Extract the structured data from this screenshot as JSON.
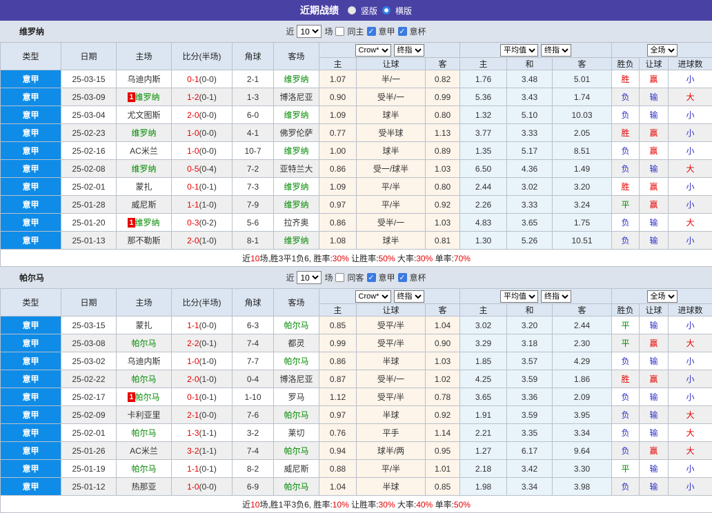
{
  "header_bar": {
    "title": "近期战绩",
    "radio_vertical_label": "竖版",
    "radio_horizontal_label": "横版"
  },
  "filter": {
    "near_label": "近",
    "games_count": "10",
    "games_suffix": "场",
    "league_checkbox_label": "意甲",
    "cup_checkbox_label": "意杯"
  },
  "table_header": {
    "type": "类型",
    "date": "日期",
    "home": "主场",
    "score": "比分(半场)",
    "corner": "角球",
    "away": "客场",
    "odds_home": "主",
    "odds_handicap": "让球",
    "odds_away": "客",
    "avg_home": "主",
    "avg_draw": "和",
    "avg_away": "客",
    "result": "胜负",
    "handicap_result": "让球",
    "goals": "进球数",
    "bookmaker_select": "Crow*",
    "final_select": "终指",
    "average_select": "平均值",
    "final_select2": "终指",
    "fulltime_select": "全场"
  },
  "colors": {
    "accent_purple": "#4a41a4",
    "league_blue": "#0e8ce8",
    "highlight_green": "#008a00",
    "red": "#e60000",
    "blue": "#2e2ec8"
  },
  "sections": [
    {
      "team": "维罗纳",
      "same_label": "同主",
      "rows": [
        {
          "league": "意甲",
          "date": "25-03-15",
          "home": {
            "badge": "",
            "name": "乌迪内斯",
            "hl": false
          },
          "ft": "0-1",
          "ht": "(0-0)",
          "corner": "2-1",
          "away": {
            "badge": "",
            "name": "维罗纳",
            "hl": true
          },
          "odds": [
            "1.07",
            "半/一",
            "0.82"
          ],
          "avg": [
            "1.76",
            "3.48",
            "5.01"
          ],
          "res": "胜",
          "let": "赢",
          "goal": "小"
        },
        {
          "league": "意甲",
          "date": "25-03-09",
          "home": {
            "badge": "1",
            "name": "维罗纳",
            "hl": true
          },
          "ft": "1-2",
          "ht": "(0-1)",
          "corner": "1-3",
          "away": {
            "badge": "",
            "name": "博洛尼亚",
            "hl": false
          },
          "odds": [
            "0.90",
            "受半/一",
            "0.99"
          ],
          "avg": [
            "5.36",
            "3.43",
            "1.74"
          ],
          "res": "负",
          "let": "输",
          "goal": "大"
        },
        {
          "league": "意甲",
          "date": "25-03-04",
          "home": {
            "badge": "",
            "name": "尤文图斯",
            "hl": false
          },
          "ft": "2-0",
          "ht": "(0-0)",
          "corner": "6-0",
          "away": {
            "badge": "",
            "name": "维罗纳",
            "hl": true
          },
          "odds": [
            "1.09",
            "球半",
            "0.80"
          ],
          "avg": [
            "1.32",
            "5.10",
            "10.03"
          ],
          "res": "负",
          "let": "输",
          "goal": "小"
        },
        {
          "league": "意甲",
          "date": "25-02-23",
          "home": {
            "badge": "",
            "name": "维罗纳",
            "hl": true
          },
          "ft": "1-0",
          "ht": "(0-0)",
          "corner": "4-1",
          "away": {
            "badge": "",
            "name": "佛罗伦萨",
            "hl": false
          },
          "odds": [
            "0.77",
            "受半球",
            "1.13"
          ],
          "avg": [
            "3.77",
            "3.33",
            "2.05"
          ],
          "res": "胜",
          "let": "赢",
          "goal": "小"
        },
        {
          "league": "意甲",
          "date": "25-02-16",
          "home": {
            "badge": "",
            "name": "AC米兰",
            "hl": false
          },
          "ft": "1-0",
          "ht": "(0-0)",
          "corner": "10-7",
          "away": {
            "badge": "",
            "name": "维罗纳",
            "hl": true
          },
          "odds": [
            "1.00",
            "球半",
            "0.89"
          ],
          "avg": [
            "1.35",
            "5.17",
            "8.51"
          ],
          "res": "负",
          "let": "赢",
          "goal": "小"
        },
        {
          "league": "意甲",
          "date": "25-02-08",
          "home": {
            "badge": "",
            "name": "维罗纳",
            "hl": true
          },
          "ft": "0-5",
          "ht": "(0-4)",
          "corner": "7-2",
          "away": {
            "badge": "",
            "name": "亚特兰大",
            "hl": false
          },
          "odds": [
            "0.86",
            "受一/球半",
            "1.03"
          ],
          "avg": [
            "6.50",
            "4.36",
            "1.49"
          ],
          "res": "负",
          "let": "输",
          "goal": "大"
        },
        {
          "league": "意甲",
          "date": "25-02-01",
          "home": {
            "badge": "",
            "name": "蒙扎",
            "hl": false
          },
          "ft": "0-1",
          "ht": "(0-1)",
          "corner": "7-3",
          "away": {
            "badge": "",
            "name": "维罗纳",
            "hl": true
          },
          "odds": [
            "1.09",
            "平/半",
            "0.80"
          ],
          "avg": [
            "2.44",
            "3.02",
            "3.20"
          ],
          "res": "胜",
          "let": "赢",
          "goal": "小"
        },
        {
          "league": "意甲",
          "date": "25-01-28",
          "home": {
            "badge": "",
            "name": "威尼斯",
            "hl": false
          },
          "ft": "1-1",
          "ht": "(1-0)",
          "corner": "7-9",
          "away": {
            "badge": "",
            "name": "维罗纳",
            "hl": true
          },
          "odds": [
            "0.97",
            "平/半",
            "0.92"
          ],
          "avg": [
            "2.26",
            "3.33",
            "3.24"
          ],
          "res": "平",
          "let": "赢",
          "goal": "小"
        },
        {
          "league": "意甲",
          "date": "25-01-20",
          "home": {
            "badge": "1",
            "name": "维罗纳",
            "hl": true
          },
          "ft": "0-3",
          "ht": "(0-2)",
          "corner": "5-6",
          "away": {
            "badge": "",
            "name": "拉齐奥",
            "hl": false
          },
          "odds": [
            "0.86",
            "受半/一",
            "1.03"
          ],
          "avg": [
            "4.83",
            "3.65",
            "1.75"
          ],
          "res": "负",
          "let": "输",
          "goal": "大"
        },
        {
          "league": "意甲",
          "date": "25-01-13",
          "home": {
            "badge": "",
            "name": "那不勒斯",
            "hl": false
          },
          "ft": "2-0",
          "ht": "(1-0)",
          "corner": "8-1",
          "away": {
            "badge": "",
            "name": "维罗纳",
            "hl": true
          },
          "odds": [
            "1.08",
            "球半",
            "0.81"
          ],
          "avg": [
            "1.30",
            "5.26",
            "10.51"
          ],
          "res": "负",
          "let": "输",
          "goal": "小"
        }
      ],
      "summary": [
        {
          "t": "近"
        },
        {
          "t": "10",
          "red": true
        },
        {
          "t": "场,胜3平1负6, 胜率:"
        },
        {
          "t": "30%",
          "red": true
        },
        {
          "t": " 让胜率:"
        },
        {
          "t": "50%",
          "red": true
        },
        {
          "t": " 大率:"
        },
        {
          "t": "30%",
          "red": true
        },
        {
          "t": " 单率:"
        },
        {
          "t": "70%",
          "red": true
        }
      ]
    },
    {
      "team": "帕尔马",
      "same_label": "同客",
      "rows": [
        {
          "league": "意甲",
          "date": "25-03-15",
          "home": {
            "badge": "",
            "name": "蒙扎",
            "hl": false
          },
          "ft": "1-1",
          "ht": "(0-0)",
          "corner": "6-3",
          "away": {
            "badge": "",
            "name": "帕尔马",
            "hl": true
          },
          "odds": [
            "0.85",
            "受平/半",
            "1.04"
          ],
          "avg": [
            "3.02",
            "3.20",
            "2.44"
          ],
          "res": "平",
          "let": "输",
          "goal": "小"
        },
        {
          "league": "意甲",
          "date": "25-03-08",
          "home": {
            "badge": "",
            "name": "帕尔马",
            "hl": true
          },
          "ft": "2-2",
          "ht": "(0-1)",
          "corner": "7-4",
          "away": {
            "badge": "",
            "name": "都灵",
            "hl": false
          },
          "odds": [
            "0.99",
            "受平/半",
            "0.90"
          ],
          "avg": [
            "3.29",
            "3.18",
            "2.30"
          ],
          "res": "平",
          "let": "赢",
          "goal": "大"
        },
        {
          "league": "意甲",
          "date": "25-03-02",
          "home": {
            "badge": "",
            "name": "乌迪内斯",
            "hl": false
          },
          "ft": "1-0",
          "ht": "(1-0)",
          "corner": "7-7",
          "away": {
            "badge": "",
            "name": "帕尔马",
            "hl": true
          },
          "odds": [
            "0.86",
            "半球",
            "1.03"
          ],
          "avg": [
            "1.85",
            "3.57",
            "4.29"
          ],
          "res": "负",
          "let": "输",
          "goal": "小"
        },
        {
          "league": "意甲",
          "date": "25-02-22",
          "home": {
            "badge": "",
            "name": "帕尔马",
            "hl": true
          },
          "ft": "2-0",
          "ht": "(1-0)",
          "corner": "0-4",
          "away": {
            "badge": "",
            "name": "博洛尼亚",
            "hl": false
          },
          "odds": [
            "0.87",
            "受半/一",
            "1.02"
          ],
          "avg": [
            "4.25",
            "3.59",
            "1.86"
          ],
          "res": "胜",
          "let": "赢",
          "goal": "小"
        },
        {
          "league": "意甲",
          "date": "25-02-17",
          "home": {
            "badge": "1",
            "name": "帕尔马",
            "hl": true
          },
          "ft": "0-1",
          "ht": "(0-1)",
          "corner": "1-10",
          "away": {
            "badge": "",
            "name": "罗马",
            "hl": false
          },
          "odds": [
            "1.12",
            "受平/半",
            "0.78"
          ],
          "avg": [
            "3.65",
            "3.36",
            "2.09"
          ],
          "res": "负",
          "let": "输",
          "goal": "小"
        },
        {
          "league": "意甲",
          "date": "25-02-09",
          "home": {
            "badge": "",
            "name": "卡利亚里",
            "hl": false
          },
          "ft": "2-1",
          "ht": "(0-0)",
          "corner": "7-6",
          "away": {
            "badge": "",
            "name": "帕尔马",
            "hl": true
          },
          "odds": [
            "0.97",
            "半球",
            "0.92"
          ],
          "avg": [
            "1.91",
            "3.59",
            "3.95"
          ],
          "res": "负",
          "let": "输",
          "goal": "大"
        },
        {
          "league": "意甲",
          "date": "25-02-01",
          "home": {
            "badge": "",
            "name": "帕尔马",
            "hl": true
          },
          "ft": "1-3",
          "ht": "(1-1)",
          "corner": "3-2",
          "away": {
            "badge": "",
            "name": "莱切",
            "hl": false
          },
          "odds": [
            "0.76",
            "平手",
            "1.14"
          ],
          "avg": [
            "2.21",
            "3.35",
            "3.34"
          ],
          "res": "负",
          "let": "输",
          "goal": "大"
        },
        {
          "league": "意甲",
          "date": "25-01-26",
          "home": {
            "badge": "",
            "name": "AC米兰",
            "hl": false
          },
          "ft": "3-2",
          "ht": "(1-1)",
          "corner": "7-4",
          "away": {
            "badge": "",
            "name": "帕尔马",
            "hl": true
          },
          "odds": [
            "0.94",
            "球半/两",
            "0.95"
          ],
          "avg": [
            "1.27",
            "6.17",
            "9.64"
          ],
          "res": "负",
          "let": "赢",
          "goal": "大"
        },
        {
          "league": "意甲",
          "date": "25-01-19",
          "home": {
            "badge": "",
            "name": "帕尔马",
            "hl": true
          },
          "ft": "1-1",
          "ht": "(0-1)",
          "corner": "8-2",
          "away": {
            "badge": "",
            "name": "威尼斯",
            "hl": false
          },
          "odds": [
            "0.88",
            "平/半",
            "1.01"
          ],
          "avg": [
            "2.18",
            "3.42",
            "3.30"
          ],
          "res": "平",
          "let": "输",
          "goal": "小"
        },
        {
          "league": "意甲",
          "date": "25-01-12",
          "home": {
            "badge": "",
            "name": "热那亚",
            "hl": false
          },
          "ft": "1-0",
          "ht": "(0-0)",
          "corner": "6-9",
          "away": {
            "badge": "",
            "name": "帕尔马",
            "hl": true
          },
          "odds": [
            "1.04",
            "半球",
            "0.85"
          ],
          "avg": [
            "1.98",
            "3.34",
            "3.98"
          ],
          "res": "负",
          "let": "输",
          "goal": "小"
        }
      ],
      "summary": [
        {
          "t": "近"
        },
        {
          "t": "10",
          "red": true
        },
        {
          "t": "场,胜1平3负6, 胜率:"
        },
        {
          "t": "10%",
          "red": true
        },
        {
          "t": " 让胜率:"
        },
        {
          "t": "30%",
          "red": true
        },
        {
          "t": " 大率:"
        },
        {
          "t": "40%",
          "red": true
        },
        {
          "t": " 单率:"
        },
        {
          "t": "50%",
          "red": true
        }
      ]
    }
  ]
}
